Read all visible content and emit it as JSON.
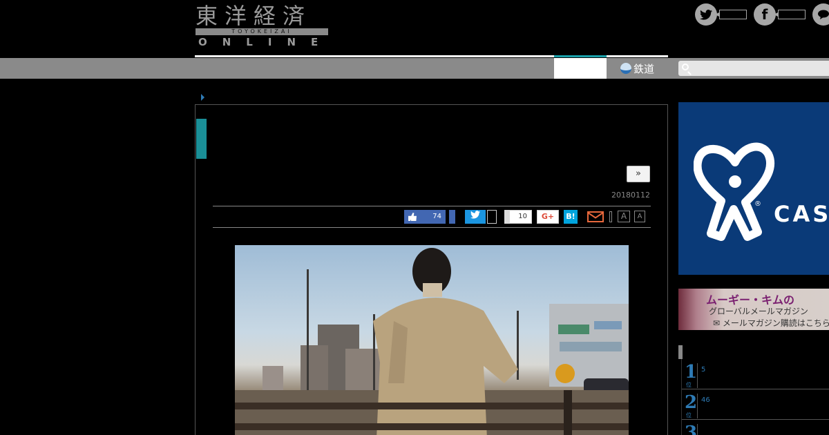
{
  "header": {
    "logo_kanji": "東洋経済",
    "logo_bar": "TOYOKEIZAI",
    "logo_online": "ONLINE"
  },
  "social": [
    {
      "name": "twitter",
      "icon": "twitter-icon"
    },
    {
      "name": "facebook",
      "icon": "facebook-icon"
    },
    {
      "name": "line",
      "icon": "chat-icon"
    }
  ],
  "nav": {
    "rail_label": "鉄道",
    "search_placeholder": ""
  },
  "article": {
    "next_label": "»",
    "date": "20180112"
  },
  "share": {
    "like_count": "74",
    "twitter_label": "t",
    "count_10": "10",
    "gplus_label": "G+",
    "hatena_label": "B!",
    "font_large": "A",
    "font_small": "A"
  },
  "sidebar": {
    "ad_main_text": "CAS",
    "ad_main_reg": "®",
    "ad2_line1": "ムーギー・キムの",
    "ad2_line2": "グローバルメールマガジン",
    "ad2_line3": "✉ メールマガジン購読はこちら",
    "ranking": [
      {
        "rank": "1",
        "sub": "位",
        "count": "5"
      },
      {
        "rank": "2",
        "sub": "位",
        "count": "46"
      },
      {
        "rank": "3",
        "sub": "",
        "count": ""
      }
    ]
  },
  "colors": {
    "accent_teal": "#1a8f97",
    "rank_blue": "#2e7bb5",
    "facebook": "#4267b2",
    "twitter": "#1b95e0",
    "hatena": "#00a4de"
  }
}
